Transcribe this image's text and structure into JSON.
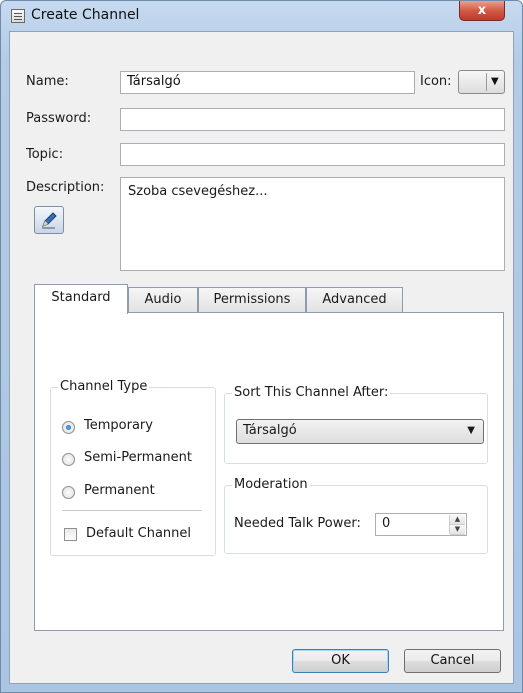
{
  "window": {
    "title": "Create Channel",
    "close_glyph": "x"
  },
  "form": {
    "name_label": "Name:",
    "name_value": "Társalgó",
    "icon_label": "Icon:",
    "password_label": "Password:",
    "password_value": "",
    "topic_label": "Topic:",
    "topic_value": "",
    "description_label": "Description:",
    "description_value": "Szoba csevegéshez..."
  },
  "tabs": [
    {
      "label": "Standard",
      "active": true
    },
    {
      "label": "Audio",
      "active": false
    },
    {
      "label": "Permissions",
      "active": false
    },
    {
      "label": "Advanced",
      "active": false
    }
  ],
  "channel_type": {
    "title": "Channel Type",
    "options": [
      {
        "label": "Temporary",
        "checked": true
      },
      {
        "label": "Semi-Permanent",
        "checked": false
      },
      {
        "label": "Permanent",
        "checked": false
      }
    ],
    "default_channel_label": "Default Channel",
    "default_channel_checked": false
  },
  "sort_after": {
    "title": "Sort This Channel After:",
    "selected": "Társalgó"
  },
  "moderation": {
    "title": "Moderation",
    "talk_power_label": "Needed Talk Power:",
    "talk_power_value": "0"
  },
  "buttons": {
    "ok": "OK",
    "cancel": "Cancel"
  },
  "colors": {
    "title_bar": "#b4cbe5",
    "close_button": "#d25a45",
    "panel_bg": "#f0f0f0",
    "default_button_border": "#3c7fb1"
  }
}
